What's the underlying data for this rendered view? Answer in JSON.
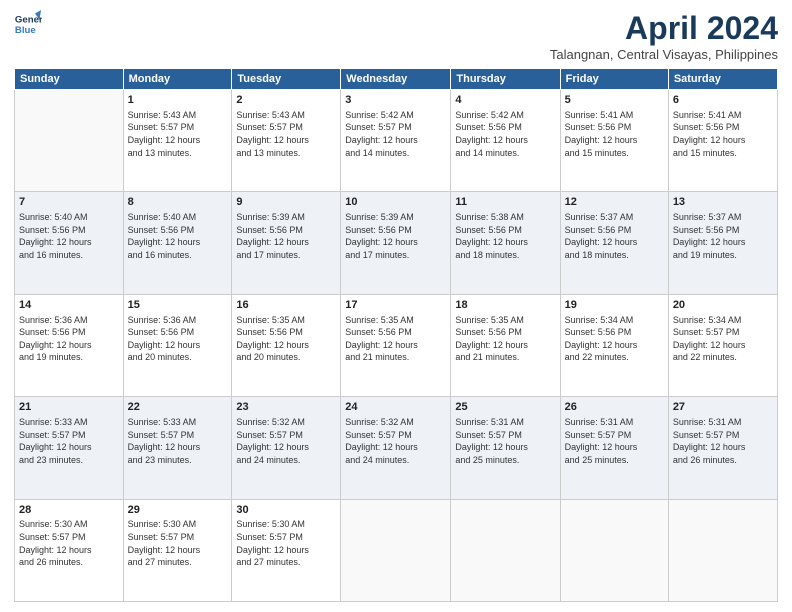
{
  "header": {
    "logo_line1": "General",
    "logo_line2": "Blue",
    "month_title": "April 2024",
    "location": "Talangnan, Central Visayas, Philippines"
  },
  "days_of_week": [
    "Sunday",
    "Monday",
    "Tuesday",
    "Wednesday",
    "Thursday",
    "Friday",
    "Saturday"
  ],
  "weeks": [
    [
      {
        "day": "",
        "info": ""
      },
      {
        "day": "1",
        "info": "Sunrise: 5:43 AM\nSunset: 5:57 PM\nDaylight: 12 hours\nand 13 minutes."
      },
      {
        "day": "2",
        "info": "Sunrise: 5:43 AM\nSunset: 5:57 PM\nDaylight: 12 hours\nand 13 minutes."
      },
      {
        "day": "3",
        "info": "Sunrise: 5:42 AM\nSunset: 5:57 PM\nDaylight: 12 hours\nand 14 minutes."
      },
      {
        "day": "4",
        "info": "Sunrise: 5:42 AM\nSunset: 5:56 PM\nDaylight: 12 hours\nand 14 minutes."
      },
      {
        "day": "5",
        "info": "Sunrise: 5:41 AM\nSunset: 5:56 PM\nDaylight: 12 hours\nand 15 minutes."
      },
      {
        "day": "6",
        "info": "Sunrise: 5:41 AM\nSunset: 5:56 PM\nDaylight: 12 hours\nand 15 minutes."
      }
    ],
    [
      {
        "day": "7",
        "info": "Sunrise: 5:40 AM\nSunset: 5:56 PM\nDaylight: 12 hours\nand 16 minutes."
      },
      {
        "day": "8",
        "info": "Sunrise: 5:40 AM\nSunset: 5:56 PM\nDaylight: 12 hours\nand 16 minutes."
      },
      {
        "day": "9",
        "info": "Sunrise: 5:39 AM\nSunset: 5:56 PM\nDaylight: 12 hours\nand 17 minutes."
      },
      {
        "day": "10",
        "info": "Sunrise: 5:39 AM\nSunset: 5:56 PM\nDaylight: 12 hours\nand 17 minutes."
      },
      {
        "day": "11",
        "info": "Sunrise: 5:38 AM\nSunset: 5:56 PM\nDaylight: 12 hours\nand 18 minutes."
      },
      {
        "day": "12",
        "info": "Sunrise: 5:37 AM\nSunset: 5:56 PM\nDaylight: 12 hours\nand 18 minutes."
      },
      {
        "day": "13",
        "info": "Sunrise: 5:37 AM\nSunset: 5:56 PM\nDaylight: 12 hours\nand 19 minutes."
      }
    ],
    [
      {
        "day": "14",
        "info": "Sunrise: 5:36 AM\nSunset: 5:56 PM\nDaylight: 12 hours\nand 19 minutes."
      },
      {
        "day": "15",
        "info": "Sunrise: 5:36 AM\nSunset: 5:56 PM\nDaylight: 12 hours\nand 20 minutes."
      },
      {
        "day": "16",
        "info": "Sunrise: 5:35 AM\nSunset: 5:56 PM\nDaylight: 12 hours\nand 20 minutes."
      },
      {
        "day": "17",
        "info": "Sunrise: 5:35 AM\nSunset: 5:56 PM\nDaylight: 12 hours\nand 21 minutes."
      },
      {
        "day": "18",
        "info": "Sunrise: 5:35 AM\nSunset: 5:56 PM\nDaylight: 12 hours\nand 21 minutes."
      },
      {
        "day": "19",
        "info": "Sunrise: 5:34 AM\nSunset: 5:56 PM\nDaylight: 12 hours\nand 22 minutes."
      },
      {
        "day": "20",
        "info": "Sunrise: 5:34 AM\nSunset: 5:57 PM\nDaylight: 12 hours\nand 22 minutes."
      }
    ],
    [
      {
        "day": "21",
        "info": "Sunrise: 5:33 AM\nSunset: 5:57 PM\nDaylight: 12 hours\nand 23 minutes."
      },
      {
        "day": "22",
        "info": "Sunrise: 5:33 AM\nSunset: 5:57 PM\nDaylight: 12 hours\nand 23 minutes."
      },
      {
        "day": "23",
        "info": "Sunrise: 5:32 AM\nSunset: 5:57 PM\nDaylight: 12 hours\nand 24 minutes."
      },
      {
        "day": "24",
        "info": "Sunrise: 5:32 AM\nSunset: 5:57 PM\nDaylight: 12 hours\nand 24 minutes."
      },
      {
        "day": "25",
        "info": "Sunrise: 5:31 AM\nSunset: 5:57 PM\nDaylight: 12 hours\nand 25 minutes."
      },
      {
        "day": "26",
        "info": "Sunrise: 5:31 AM\nSunset: 5:57 PM\nDaylight: 12 hours\nand 25 minutes."
      },
      {
        "day": "27",
        "info": "Sunrise: 5:31 AM\nSunset: 5:57 PM\nDaylight: 12 hours\nand 26 minutes."
      }
    ],
    [
      {
        "day": "28",
        "info": "Sunrise: 5:30 AM\nSunset: 5:57 PM\nDaylight: 12 hours\nand 26 minutes."
      },
      {
        "day": "29",
        "info": "Sunrise: 5:30 AM\nSunset: 5:57 PM\nDaylight: 12 hours\nand 27 minutes."
      },
      {
        "day": "30",
        "info": "Sunrise: 5:30 AM\nSunset: 5:57 PM\nDaylight: 12 hours\nand 27 minutes."
      },
      {
        "day": "",
        "info": ""
      },
      {
        "day": "",
        "info": ""
      },
      {
        "day": "",
        "info": ""
      },
      {
        "day": "",
        "info": ""
      }
    ]
  ]
}
